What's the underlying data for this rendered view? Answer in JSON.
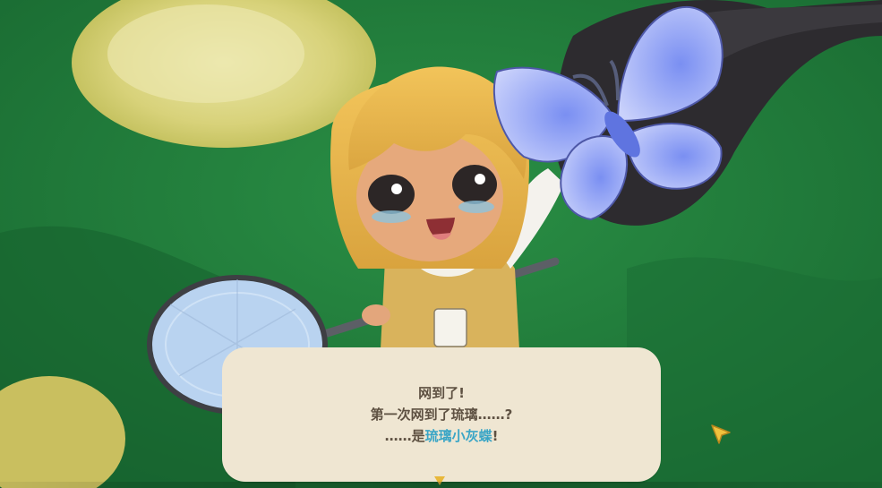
{
  "dialog": {
    "line1": "网到了!",
    "line2": "第一次网到了琉璃……?",
    "line3_prefix": "……是",
    "line3_highlight": "琉璃小灰蝶",
    "line3_suffix": "!"
  },
  "colors": {
    "dialog_bg": "#efe6d2",
    "dialog_text": "#5e5142",
    "highlight_text": "#39a5c6",
    "grass": "#1f7d3c",
    "cursor": "#e8b83a"
  },
  "icons": {
    "cursor": "arrow-pointer-icon",
    "dialog_indicator": "down-triangle-icon"
  }
}
